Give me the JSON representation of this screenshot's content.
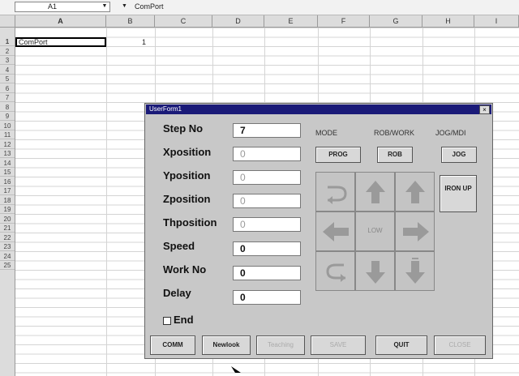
{
  "formula_bar": {
    "name_box": "A1",
    "content": "ComPort"
  },
  "columns": [
    "A",
    "B",
    "C",
    "D",
    "E",
    "F",
    "G",
    "H",
    "I"
  ],
  "rows": [
    "1",
    "2",
    "3",
    "4",
    "5",
    "6",
    "7",
    "8",
    "9",
    "10",
    "11",
    "12",
    "13",
    "14",
    "15",
    "16",
    "17",
    "18",
    "19",
    "20",
    "21",
    "22",
    "23",
    "24",
    "25"
  ],
  "cells": {
    "a1": "ComPort",
    "b1": "1"
  },
  "dialog": {
    "title": "UserForm1",
    "close": "×",
    "fields": [
      {
        "label": "Step No",
        "value": "7"
      },
      {
        "label": "Xposition",
        "value": "0"
      },
      {
        "label": "Yposition",
        "value": "0"
      },
      {
        "label": "Zposition",
        "value": "0"
      },
      {
        "label": "Thposition",
        "value": "0"
      },
      {
        "label": "Speed",
        "value": "0"
      },
      {
        "label": "Work No",
        "value": "0"
      },
      {
        "label": "Delay",
        "value": "0"
      }
    ],
    "mode_labels": [
      "MODE",
      "ROB/WORK",
      "JOG/MDI"
    ],
    "mode_buttons": [
      "PROG",
      "ROB",
      "JOG"
    ],
    "iron_button": "IRON UP",
    "jog_center": "LOW",
    "end_checkbox": "End",
    "bottom_buttons": [
      "COMM",
      "Newlook",
      "Teaching",
      "SAVE",
      "QUIT",
      "CLOSE"
    ]
  },
  "colors": {
    "titlebar": "#1a1a78",
    "dialog": "#c8c8c8",
    "jog_arrow": "#9a9a9a"
  }
}
